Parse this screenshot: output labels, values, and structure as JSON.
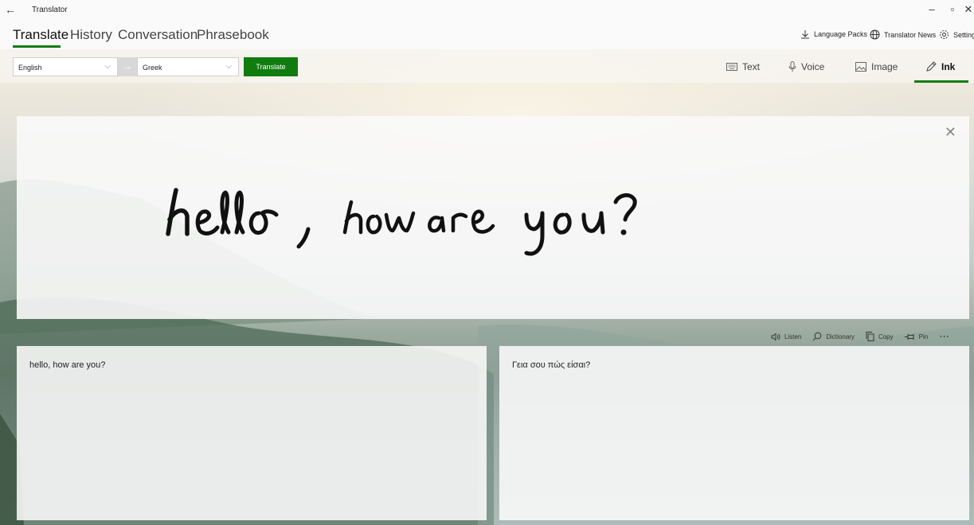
{
  "window": {
    "title": "Translator"
  },
  "nav": {
    "tabs": [
      {
        "label": "Translate",
        "active": true
      },
      {
        "label": "History",
        "active": false
      },
      {
        "label": "Conversation",
        "active": false
      },
      {
        "label": "Phrasebook",
        "active": false
      }
    ],
    "links": {
      "language_packs": "Language Packs",
      "translator_news": "Translator News",
      "settings": "Settings"
    }
  },
  "langbar": {
    "from_language": "English",
    "to_language": "Greek",
    "translate_label": "Translate",
    "modes": [
      {
        "label": "Text",
        "icon": "keyboard-icon",
        "active": false
      },
      {
        "label": "Voice",
        "icon": "microphone-icon",
        "active": false
      },
      {
        "label": "Image",
        "icon": "image-icon",
        "active": false
      },
      {
        "label": "Ink",
        "icon": "pen-icon",
        "active": true
      }
    ]
  },
  "ink": {
    "handwriting": "hello , how are you?"
  },
  "output_tools": {
    "listen": "Listen",
    "dictionary": "Dictionary",
    "copy": "Copy",
    "pin": "Pin",
    "more": "⋯"
  },
  "source_text": "hello, how are you?",
  "translated_text": "Γεια σου πώς είσαι?",
  "colors": {
    "accent": "#107c10"
  }
}
